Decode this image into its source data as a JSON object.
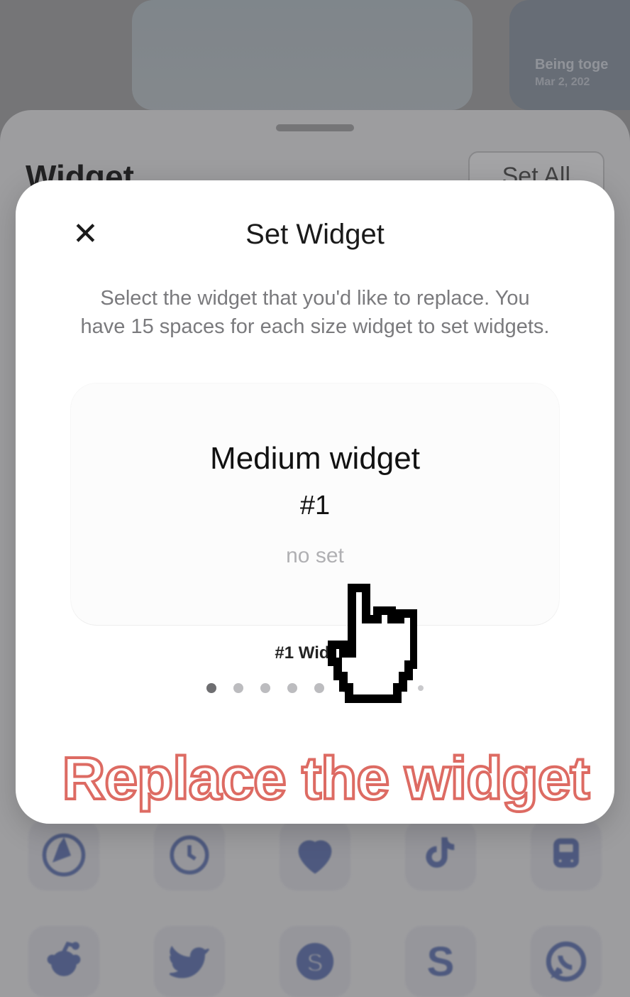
{
  "bg_preview2": {
    "line1": "Being toge",
    "line2": "Mar 2, 202"
  },
  "sheet1": {
    "title": "Widget",
    "set_all_label": "Set All"
  },
  "modal": {
    "title": "Set Widget",
    "description": "Select the widget that you'd like to replace. You have 15 spaces for each size widget to set widgets.",
    "card": {
      "title": "Medium widget",
      "number": "#1",
      "status": "no set",
      "caption": "#1 Widget"
    },
    "page_dots": {
      "count": 9,
      "active_index": 0
    }
  },
  "caption": "Replace the widget",
  "icons_row1": [
    "safari",
    "clock",
    "heart",
    "tiktok",
    "transit"
  ],
  "icons_row2": [
    "reddit",
    "twitter",
    "skype",
    "s",
    "whatsapp"
  ]
}
